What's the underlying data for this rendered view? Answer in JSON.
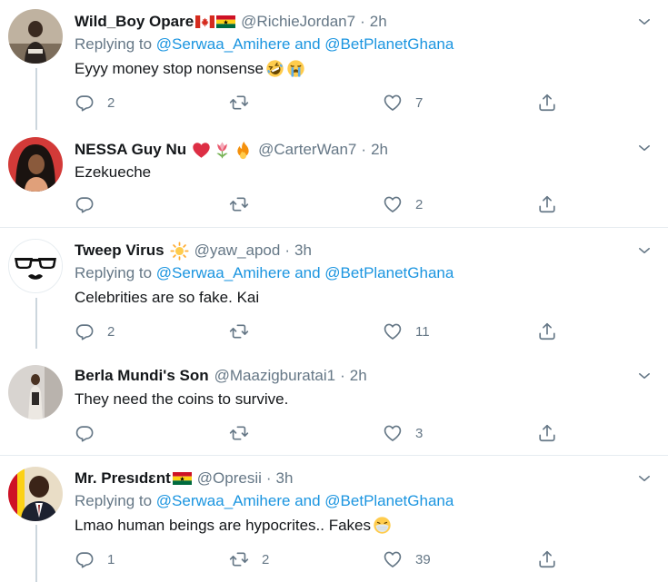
{
  "reply_prefix": "Replying to",
  "reply_and": "and",
  "separator": "·",
  "tweets": [
    {
      "name": "Wild_Boy Opare",
      "handle": "@RichieJordan7",
      "time": "2h",
      "name_emojis": [
        "canada-flag",
        "ghana-flag"
      ],
      "replying_to": [
        "@Serwaa_Amihere",
        "@BetPlanetGhana"
      ],
      "text": "Eyyy money stop nonsense",
      "text_emojis": [
        "rofl-emoji",
        "loudly-crying-emoji"
      ],
      "replies": "2",
      "retweets": "",
      "likes": "7"
    },
    {
      "name": "NESSA Guy Nu",
      "handle": "@CarterWan7",
      "time": "2h",
      "name_emojis": [
        "red-heart",
        "tulip",
        "fire"
      ],
      "replying_to": [],
      "text": "Ezekueche",
      "text_emojis": [],
      "replies": "",
      "retweets": "",
      "likes": "2"
    },
    {
      "name": "Tweep Virus",
      "handle": "@yaw_apod",
      "time": "3h",
      "name_emojis": [
        "sun"
      ],
      "replying_to": [
        "@Serwaa_Amihere",
        "@BetPlanetGhana"
      ],
      "text": "Celebrities are so fake. Kai",
      "text_emojis": [],
      "replies": "2",
      "retweets": "",
      "likes": "11"
    },
    {
      "name": "Berla Mundi's Son",
      "handle": "@Maazigburatai1",
      "time": "2h",
      "name_emojis": [],
      "replying_to": [],
      "text": "They need the coins to survive.",
      "text_emojis": [],
      "replies": "",
      "retweets": "",
      "likes": "3"
    },
    {
      "name": "Mr. Presıdɛnt",
      "handle": "@Opresii",
      "time": "3h",
      "name_emojis": [
        "ghana-flag"
      ],
      "replying_to": [
        "@Serwaa_Amihere",
        "@BetPlanetGhana"
      ],
      "text": "Lmao human beings are hypocrites.. Fakes",
      "text_emojis": [
        "face-with-medical-mask"
      ],
      "replies": "1",
      "retweets": "2",
      "likes": "39"
    }
  ],
  "colors": {
    "name": "#14171a",
    "muted": "#657786",
    "mention": "#1b95e0",
    "divider": "#e6ecf0",
    "thread_line": "#ccd6dd"
  }
}
